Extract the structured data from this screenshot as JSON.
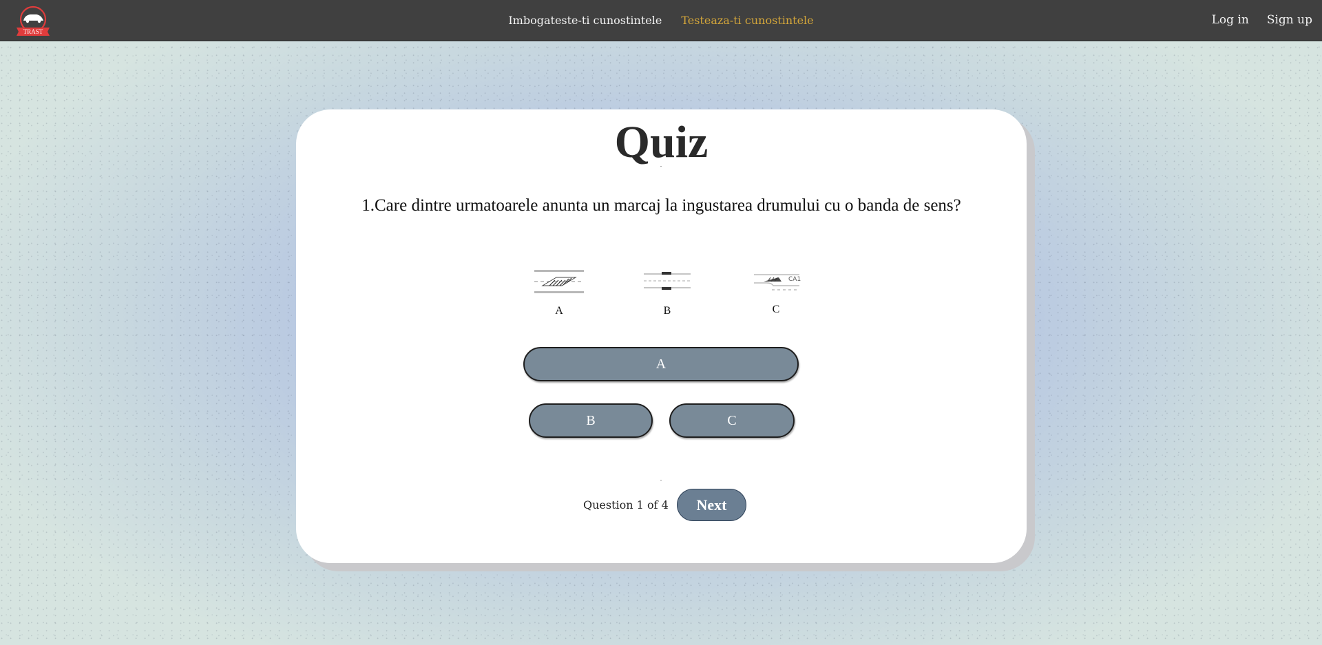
{
  "nav": {
    "logo_text": "TRAST",
    "links": [
      {
        "label": "Imbogateste-ti cunostintele",
        "active": false
      },
      {
        "label": "Testeaza-ti cunostintele",
        "active": true
      }
    ],
    "auth": {
      "login": "Log in",
      "signup": "Sign up"
    }
  },
  "quiz": {
    "title": "Quiz",
    "question": "1.Care dintre urmatoarele anunta un marcaj la ingustarea drumului cu o banda de sens?",
    "option_images": [
      {
        "label": "A",
        "icon": "road-marking-a-icon"
      },
      {
        "label": "B",
        "icon": "road-marking-b-icon"
      },
      {
        "label": "C",
        "icon": "road-marking-c-icon"
      }
    ],
    "answers": [
      "A",
      "B",
      "C"
    ],
    "counter": "Question 1 of 4",
    "next_label": "Next"
  },
  "colors": {
    "navbar_bg": "#404040",
    "active_link": "#d4a63a",
    "answer_button": "#798a98",
    "next_button": "#6b7f93"
  }
}
